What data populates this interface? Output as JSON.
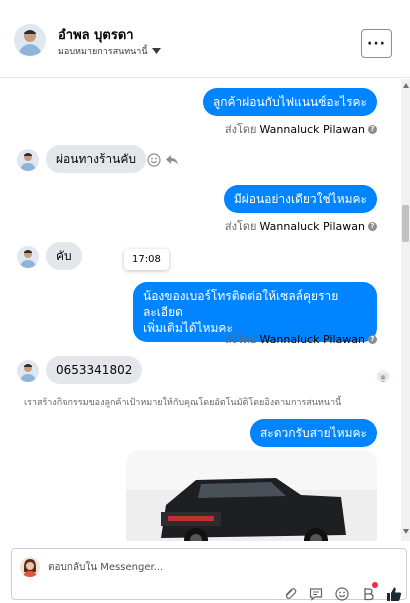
{
  "header": {
    "contact_name": "อำพล บุตรดา",
    "assign_label": "มอบหมายการสนทนานี้",
    "menu_label": "···"
  },
  "messages": [
    {
      "dir": "out",
      "text": "ลูกค้าผ่อนกับไฟแนนซ์อะไรคะ",
      "sent_prefix": "ส่งโดย",
      "sender": "Wannaluck Pilawan"
    },
    {
      "dir": "in",
      "text": "ผ่อนทางร้านคับ"
    },
    {
      "dir": "out",
      "text": "มีผ่อนอย่างเดียวใช่ไหมคะ",
      "sent_prefix": "ส่งโดย",
      "sender": "Wannaluck Pilawan"
    },
    {
      "dir": "in",
      "text": "คับ"
    },
    {
      "dir": "out",
      "text_line1": "น้องของเบอร์โทรติดต่อให้เซลล์คุยรายละเอียด",
      "text_line2": "เพิ่มเติมได้ไหมคะ",
      "sent_prefix": "ส่งโดย",
      "sender": "Wannaluck Pilawan"
    },
    {
      "dir": "in",
      "text": "0653341802"
    },
    {
      "dir": "out",
      "text": "สะดวกรับสายไหมคะ"
    }
  ],
  "tooltip_time": "17:08",
  "auto_note": "เราสร้างกิจกรรมของลูกค้าเป้าหมายให้กับคุณโดยอัตโนมัติโดยอิงตามการสนทนานี้",
  "help_glyph": "?",
  "composer": {
    "placeholder": "ตอบกลับใน Messenger..."
  },
  "colors": {
    "outgoing_bubble": "#0084ff",
    "incoming_bubble": "#e4e6eb",
    "like_icon": "#1c2b33",
    "notification_dot": "#f02849"
  },
  "icons": [
    "chevron-down-icon",
    "emoji-icon",
    "reply-icon",
    "help-icon",
    "attachment-icon",
    "saved-reply-icon",
    "emoji-icon",
    "payment-icon",
    "like-icon"
  ]
}
